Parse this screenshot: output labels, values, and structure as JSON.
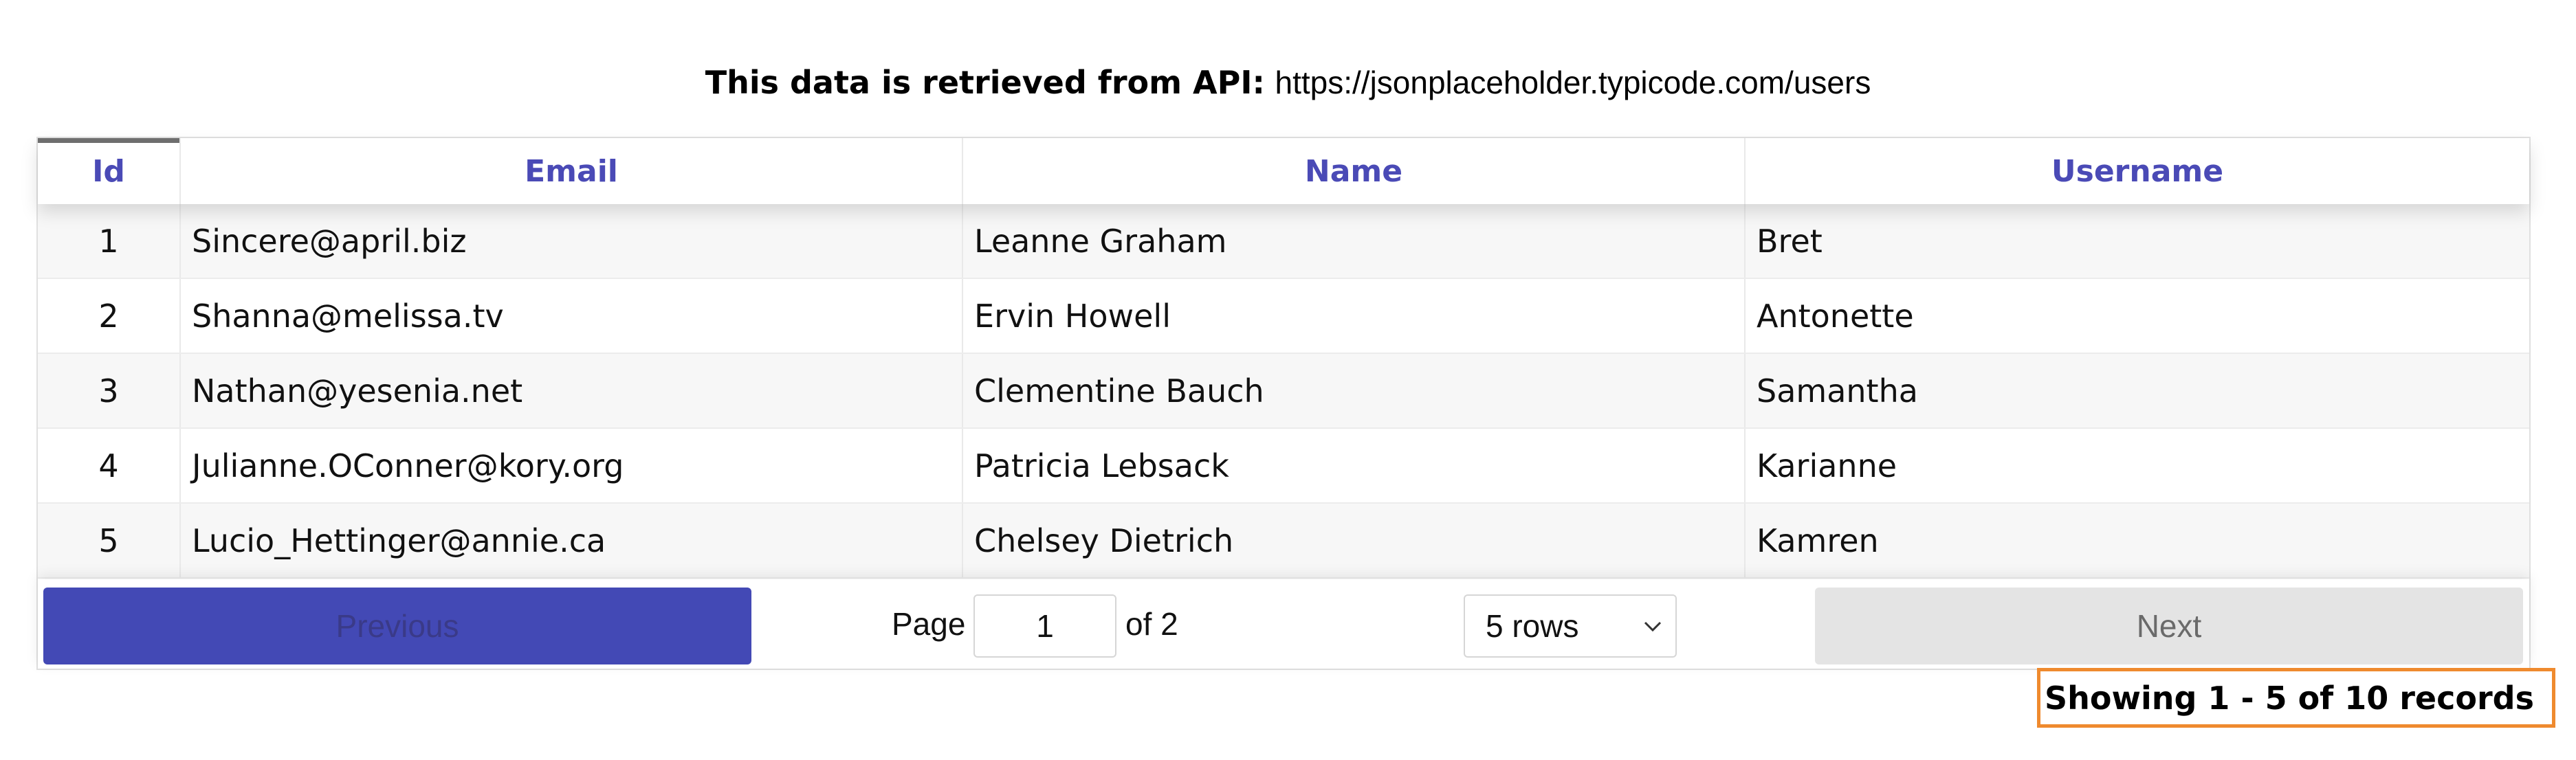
{
  "caption": {
    "lead": "This data is retrieved from API:",
    "url": "https://jsonplaceholder.typicode.com/users"
  },
  "table": {
    "headers": {
      "id": "Id",
      "email": "Email",
      "name": "Name",
      "username": "Username"
    },
    "rows": [
      {
        "id": "1",
        "email": "Sincere@april.biz",
        "name": "Leanne Graham",
        "username": "Bret"
      },
      {
        "id": "2",
        "email": "Shanna@melissa.tv",
        "name": "Ervin Howell",
        "username": "Antonette"
      },
      {
        "id": "3",
        "email": "Nathan@yesenia.net",
        "name": "Clementine Bauch",
        "username": "Samantha"
      },
      {
        "id": "4",
        "email": "Julianne.OConner@kory.org",
        "name": "Patricia Lebsack",
        "username": "Karianne"
      },
      {
        "id": "5",
        "email": "Lucio_Hettinger@annie.ca",
        "name": "Chelsey Dietrich",
        "username": "Kamren"
      }
    ]
  },
  "pagination": {
    "previous_label": "Previous",
    "next_label": "Next",
    "page_label": "Page",
    "current_page": "1",
    "of_label": "of 2",
    "rows_option": "5 rows"
  },
  "records_text": "Showing 1 - 5 of 10 records",
  "colors": {
    "header_text": "#4a4ab6",
    "previous_button": "#4349b5",
    "next_button": "#e4e4e4",
    "records_border": "#ef8a2e"
  },
  "icons": {
    "rows_select": "chevron-down-icon"
  }
}
